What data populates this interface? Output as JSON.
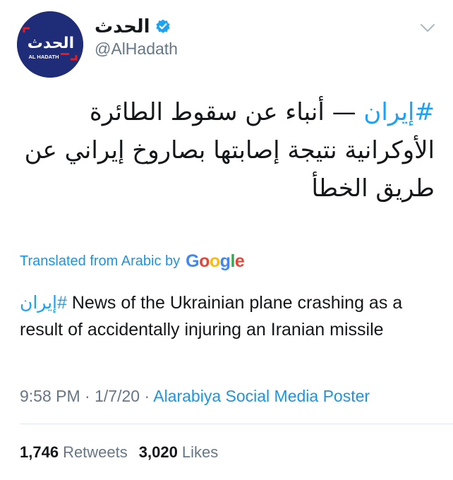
{
  "user": {
    "display_name": "الحدث",
    "handle": "@AlHadath",
    "avatar_logo_text": "الحدث",
    "avatar_sub_text": "AL HADATH"
  },
  "tweet": {
    "hashtag": "#إيران",
    "text_rest": " — أنباء عن سقوط الطائرة الأوكرانية نتيجة إصابتها بصاروخ إيراني عن طريق الخطأ"
  },
  "translation": {
    "label": "Translated from Arabic by",
    "google_letters": [
      "G",
      "o",
      "o",
      "g",
      "l",
      "e"
    ],
    "hashtag": "إيران#",
    "text": " News of the Ukrainian plane crashing as a result of accidentally injuring an Iranian missile"
  },
  "meta": {
    "time": "9:58 PM",
    "date": "1/7/20",
    "separator": " · ",
    "source": "Alarabiya Social Media Poster"
  },
  "stats": {
    "retweets_count": "1,746",
    "retweets_label": "Retweets",
    "likes_count": "3,020",
    "likes_label": "Likes"
  },
  "colors": {
    "link": "#1da1f2",
    "secondary": "#657786",
    "avatar_bg": "#1f2c77",
    "logo_red": "#e31b23"
  },
  "icons": {
    "verified": "verified-badge-icon",
    "chevron": "chevron-down-icon"
  }
}
